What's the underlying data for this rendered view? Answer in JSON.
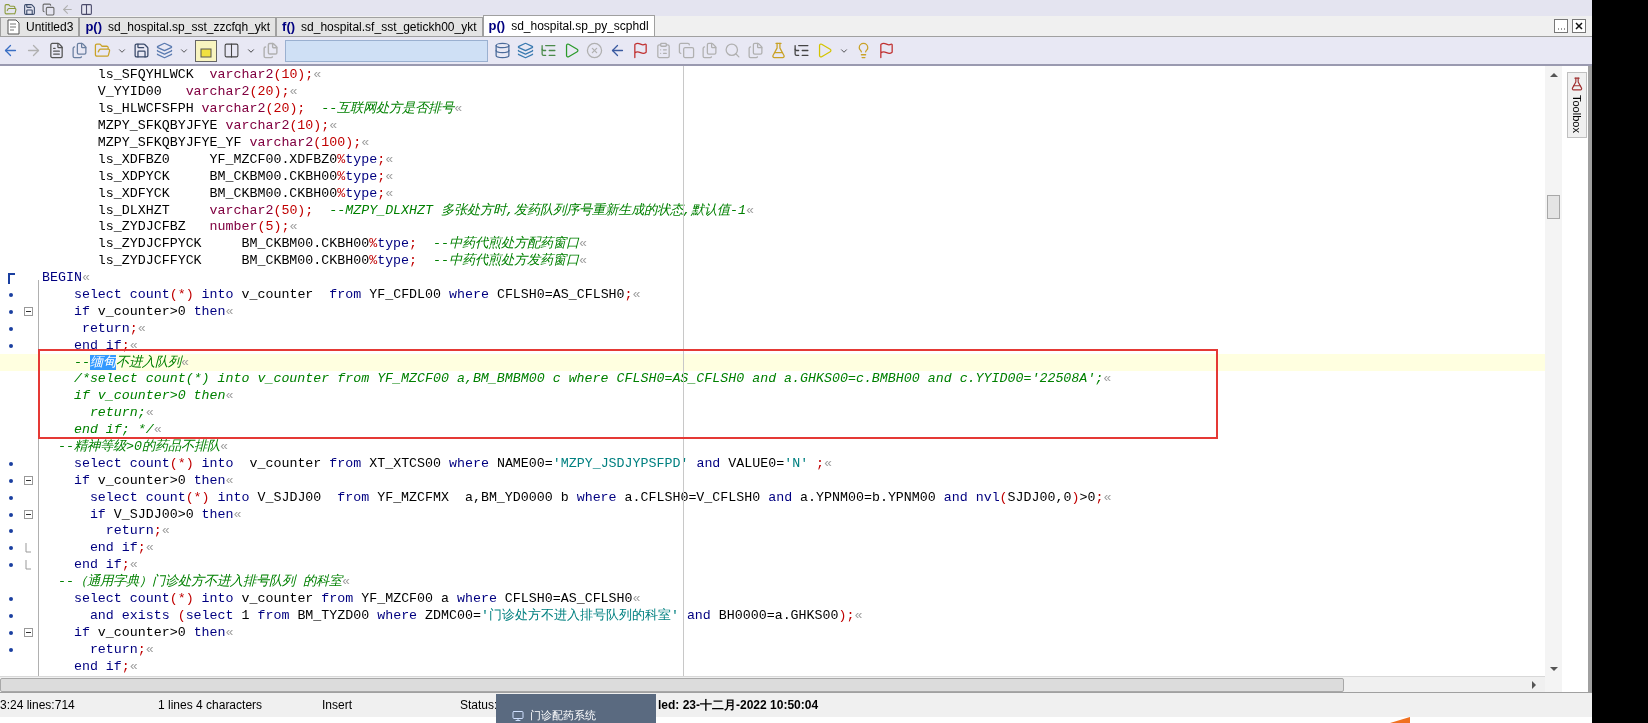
{
  "tabs": [
    {
      "kind": "sql",
      "label": "Untitled3",
      "selected": false
    },
    {
      "kind": "proc",
      "icon_text": "p()",
      "label": "sd_hospital.sp_sst_zzcfqh_ykt",
      "selected": false
    },
    {
      "kind": "proc",
      "icon_text": "f()",
      "label": "sd_hospital.sf_sst_getickh00_ykt",
      "selected": false
    },
    {
      "kind": "proc",
      "icon_text": "p()",
      "label": "sd_hospital.sp_py_scphdl",
      "selected": true
    }
  ],
  "toolbox": {
    "label": "Toolbox"
  },
  "editor": {
    "lines": [
      {
        "current": false,
        "spans": [
          {
            "kind": "plain",
            "text": "       ls_SFQYHLWCK  "
          },
          {
            "kind": "type",
            "text": "varchar2"
          },
          {
            "kind": "symbol",
            "text": "(10);"
          },
          {
            "kind": "eol",
            "text": "«"
          }
        ]
      },
      {
        "current": false,
        "spans": [
          {
            "kind": "plain",
            "text": "       V_YYID00   "
          },
          {
            "kind": "type",
            "text": "varchar2"
          },
          {
            "kind": "symbol",
            "text": "(20);"
          },
          {
            "kind": "eol",
            "text": "«"
          }
        ]
      },
      {
        "current": false,
        "spans": [
          {
            "kind": "plain",
            "text": "       ls_HLWCFSFPH "
          },
          {
            "kind": "type",
            "text": "varchar2"
          },
          {
            "kind": "symbol",
            "text": "(20);"
          },
          {
            "kind": "comment",
            "text": "  --互联网处方是否排号"
          },
          {
            "kind": "eol",
            "text": "«"
          }
        ]
      },
      {
        "current": false,
        "spans": [
          {
            "kind": "plain",
            "text": "       MZPY_SFKQBYJFYE "
          },
          {
            "kind": "type",
            "text": "varchar2"
          },
          {
            "kind": "symbol",
            "text": "(10);"
          },
          {
            "kind": "eol",
            "text": "«"
          }
        ]
      },
      {
        "current": false,
        "spans": [
          {
            "kind": "plain",
            "text": "       MZPY_SFKQBYJFYE_YF "
          },
          {
            "kind": "type",
            "text": "varchar2"
          },
          {
            "kind": "symbol",
            "text": "(100);"
          },
          {
            "kind": "eol",
            "text": "«"
          }
        ]
      },
      {
        "current": false,
        "spans": [
          {
            "kind": "plain",
            "text": "       ls_XDFBZ0     YF_MZCF00.XDFBZ0"
          },
          {
            "kind": "symbol",
            "text": "%"
          },
          {
            "kind": "keyword",
            "text": "type"
          },
          {
            "kind": "symbol",
            "text": ";"
          },
          {
            "kind": "eol",
            "text": "«"
          }
        ]
      },
      {
        "current": false,
        "spans": [
          {
            "kind": "plain",
            "text": "       ls_XDPYCK     BM_CKBM00.CKBH00"
          },
          {
            "kind": "symbol",
            "text": "%"
          },
          {
            "kind": "keyword",
            "text": "type"
          },
          {
            "kind": "symbol",
            "text": ";"
          },
          {
            "kind": "eol",
            "text": "«"
          }
        ]
      },
      {
        "current": false,
        "spans": [
          {
            "kind": "plain",
            "text": "       ls_XDFYCK     BM_CKBM00.CKBH00"
          },
          {
            "kind": "symbol",
            "text": "%"
          },
          {
            "kind": "keyword",
            "text": "type"
          },
          {
            "kind": "symbol",
            "text": ";"
          },
          {
            "kind": "eol",
            "text": "«"
          }
        ]
      },
      {
        "current": false,
        "spans": [
          {
            "kind": "plain",
            "text": "       ls_DLXHZT     "
          },
          {
            "kind": "type",
            "text": "varchar2"
          },
          {
            "kind": "symbol",
            "text": "(50);"
          },
          {
            "kind": "comment",
            "text": "  --MZPY_DLXHZT 多张处方时,发药队列序号重新生成的状态,默认值-1"
          },
          {
            "kind": "eol",
            "text": "«"
          }
        ]
      },
      {
        "current": false,
        "spans": [
          {
            "kind": "plain",
            "text": "       ls_ZYDJCFBZ   "
          },
          {
            "kind": "type",
            "text": "number"
          },
          {
            "kind": "symbol",
            "text": "(5);"
          },
          {
            "kind": "eol",
            "text": "«"
          }
        ]
      },
      {
        "current": false,
        "spans": [
          {
            "kind": "plain",
            "text": "       ls_ZYDJCFPYCK     BM_CKBM00.CKBH00"
          },
          {
            "kind": "symbol",
            "text": "%"
          },
          {
            "kind": "keyword",
            "text": "type"
          },
          {
            "kind": "symbol",
            "text": ";"
          },
          {
            "kind": "comment",
            "text": "  --中药代煎处方配药窗口"
          },
          {
            "kind": "eol",
            "text": "«"
          }
        ]
      },
      {
        "current": false,
        "spans": [
          {
            "kind": "plain",
            "text": "       ls_ZYDJCFFYCK     BM_CKBM00.CKBH00"
          },
          {
            "kind": "symbol",
            "text": "%"
          },
          {
            "kind": "keyword",
            "text": "type"
          },
          {
            "kind": "symbol",
            "text": ";"
          },
          {
            "kind": "comment",
            "text": "  --中药代煎处方发药窗口"
          },
          {
            "kind": "eol",
            "text": "«"
          }
        ]
      },
      {
        "block_start": true,
        "current": false,
        "spans": [
          {
            "kind": "keyword",
            "text": "BEGIN"
          },
          {
            "kind": "eol",
            "text": "«"
          }
        ]
      },
      {
        "executable": true,
        "current": false,
        "spans": [
          {
            "kind": "keyword",
            "text": "    select "
          },
          {
            "kind": "keyword",
            "text": "count"
          },
          {
            "kind": "symbol",
            "text": "(*)"
          },
          {
            "kind": "keyword",
            "text": " into"
          },
          {
            "kind": "plain",
            "text": " v_counter  "
          },
          {
            "kind": "keyword",
            "text": "from"
          },
          {
            "kind": "plain",
            "text": " YF_CFDL00 "
          },
          {
            "kind": "keyword",
            "text": "where"
          },
          {
            "kind": "plain",
            "text": " CFLSH0=AS_CFLSH0"
          },
          {
            "kind": "symbol",
            "text": ";"
          },
          {
            "kind": "eol",
            "text": "«"
          }
        ]
      },
      {
        "executable": true,
        "fold_open": true,
        "current": false,
        "spans": [
          {
            "kind": "keyword",
            "text": "    if"
          },
          {
            "kind": "plain",
            "text": " v_counter>0 "
          },
          {
            "kind": "keyword",
            "text": "then"
          },
          {
            "kind": "eol",
            "text": "«"
          }
        ]
      },
      {
        "executable": true,
        "current": false,
        "spans": [
          {
            "kind": "keyword",
            "text": "     return"
          },
          {
            "kind": "symbol",
            "text": ";"
          },
          {
            "kind": "eol",
            "text": "«"
          }
        ]
      },
      {
        "executable": true,
        "current": false,
        "spans": [
          {
            "kind": "keyword",
            "text": "    end if"
          },
          {
            "kind": "symbol",
            "text": ";"
          },
          {
            "kind": "eol",
            "text": "«"
          }
        ]
      },
      {
        "current": true,
        "spans": [
          {
            "kind": "comment",
            "text": "    --"
          },
          {
            "kind": "selection",
            "text": "缅甸"
          },
          {
            "kind": "comment",
            "text": "不进入队列"
          },
          {
            "kind": "eol",
            "text": "«"
          }
        ]
      },
      {
        "current": false,
        "spans": [
          {
            "kind": "comment",
            "text": "    /*select count(*) into v_counter from YF_MZCF00 a,BM_BMBM00 c where CFLSH0=AS_CFLSH0 and a.GHKS00=c.BMBH00 and c.YYID00='22508A';"
          },
          {
            "kind": "eol",
            "text": "«"
          }
        ]
      },
      {
        "current": false,
        "spans": [
          {
            "kind": "comment",
            "text": "    if v_counter>0 then"
          },
          {
            "kind": "eol",
            "text": "«"
          }
        ]
      },
      {
        "current": false,
        "spans": [
          {
            "kind": "comment",
            "text": "      return;"
          },
          {
            "kind": "eol",
            "text": "«"
          }
        ]
      },
      {
        "current": false,
        "spans": [
          {
            "kind": "comment",
            "text": "    end if; */"
          },
          {
            "kind": "eol",
            "text": "«"
          }
        ]
      },
      {
        "current": false,
        "spans": [
          {
            "kind": "comment",
            "text": "  --精神等级>0的药品不排队"
          },
          {
            "kind": "eol",
            "text": "«"
          }
        ]
      },
      {
        "executable": true,
        "current": false,
        "spans": [
          {
            "kind": "keyword",
            "text": "    select "
          },
          {
            "kind": "keyword",
            "text": "count"
          },
          {
            "kind": "symbol",
            "text": "(*)"
          },
          {
            "kind": "keyword",
            "text": " into"
          },
          {
            "kind": "plain",
            "text": "  v_counter "
          },
          {
            "kind": "keyword",
            "text": "from"
          },
          {
            "kind": "plain",
            "text": " XT_XTCS00 "
          },
          {
            "kind": "keyword",
            "text": "where"
          },
          {
            "kind": "plain",
            "text": " NAME00="
          },
          {
            "kind": "string",
            "text": "'MZPY_JSDJYPSFPD'"
          },
          {
            "kind": "keyword",
            "text": " and"
          },
          {
            "kind": "plain",
            "text": " VALUE0="
          },
          {
            "kind": "string",
            "text": "'N'"
          },
          {
            "kind": "symbol",
            "text": " ;"
          },
          {
            "kind": "eol",
            "text": "«"
          }
        ]
      },
      {
        "executable": true,
        "fold_open": true,
        "current": false,
        "spans": [
          {
            "kind": "keyword",
            "text": "    if"
          },
          {
            "kind": "plain",
            "text": " v_counter>0 "
          },
          {
            "kind": "keyword",
            "text": "then"
          },
          {
            "kind": "eol",
            "text": "«"
          }
        ]
      },
      {
        "executable": true,
        "current": false,
        "spans": [
          {
            "kind": "keyword",
            "text": "      select "
          },
          {
            "kind": "keyword",
            "text": "count"
          },
          {
            "kind": "symbol",
            "text": "(*)"
          },
          {
            "kind": "keyword",
            "text": " into"
          },
          {
            "kind": "plain",
            "text": " V_SJDJ00  "
          },
          {
            "kind": "keyword",
            "text": "from"
          },
          {
            "kind": "plain",
            "text": " YF_MZCFMX  a,BM_YD0000 b "
          },
          {
            "kind": "keyword",
            "text": "where"
          },
          {
            "kind": "plain",
            "text": " a.CFLSH0=V_CFLSH0 "
          },
          {
            "kind": "keyword",
            "text": "and"
          },
          {
            "kind": "plain",
            "text": " a.YPNM00=b.YPNM00 "
          },
          {
            "kind": "keyword",
            "text": "and nvl"
          },
          {
            "kind": "symbol",
            "text": "("
          },
          {
            "kind": "plain",
            "text": "SJDJ00,0"
          },
          {
            "kind": "symbol",
            "text": ")"
          },
          {
            "kind": "plain",
            "text": ">0"
          },
          {
            "kind": "symbol",
            "text": ";"
          },
          {
            "kind": "eol",
            "text": "«"
          }
        ]
      },
      {
        "executable": true,
        "fold_open": true,
        "current": false,
        "spans": [
          {
            "kind": "keyword",
            "text": "      if"
          },
          {
            "kind": "plain",
            "text": " V_SJDJ00>0 "
          },
          {
            "kind": "keyword",
            "text": "then"
          },
          {
            "kind": "eol",
            "text": "«"
          }
        ]
      },
      {
        "executable": true,
        "current": false,
        "spans": [
          {
            "kind": "keyword",
            "text": "        return"
          },
          {
            "kind": "symbol",
            "text": ";"
          },
          {
            "kind": "eol",
            "text": "«"
          }
        ]
      },
      {
        "executable": true,
        "fold_end": true,
        "current": false,
        "spans": [
          {
            "kind": "keyword",
            "text": "      end if"
          },
          {
            "kind": "symbol",
            "text": ";"
          },
          {
            "kind": "eol",
            "text": "«"
          }
        ]
      },
      {
        "executable": true,
        "fold_end": true,
        "current": false,
        "spans": [
          {
            "kind": "keyword",
            "text": "    end if"
          },
          {
            "kind": "symbol",
            "text": ";"
          },
          {
            "kind": "eol",
            "text": "«"
          }
        ]
      },
      {
        "current": false,
        "spans": [
          {
            "kind": "comment",
            "text": "  --（通用字典）门诊处方不进入排号队列 的科室"
          },
          {
            "kind": "eol",
            "text": "«"
          }
        ]
      },
      {
        "executable": true,
        "current": false,
        "spans": [
          {
            "kind": "keyword",
            "text": "    select "
          },
          {
            "kind": "keyword",
            "text": "count"
          },
          {
            "kind": "symbol",
            "text": "(*)"
          },
          {
            "kind": "keyword",
            "text": " into"
          },
          {
            "kind": "plain",
            "text": " v_counter "
          },
          {
            "kind": "keyword",
            "text": "from"
          },
          {
            "kind": "plain",
            "text": " YF_MZCF00 a "
          },
          {
            "kind": "keyword",
            "text": "where"
          },
          {
            "kind": "plain",
            "text": " CFLSH0=AS_CFLSH0"
          },
          {
            "kind": "eol",
            "text": "«"
          }
        ]
      },
      {
        "executable": true,
        "current": false,
        "spans": [
          {
            "kind": "keyword",
            "text": "      and exists"
          },
          {
            "kind": "symbol",
            "text": " ("
          },
          {
            "kind": "keyword",
            "text": "select"
          },
          {
            "kind": "plain",
            "text": " 1 "
          },
          {
            "kind": "keyword",
            "text": "from"
          },
          {
            "kind": "plain",
            "text": " BM_TYZD00 "
          },
          {
            "kind": "keyword",
            "text": "where"
          },
          {
            "kind": "plain",
            "text": " ZDMC00="
          },
          {
            "kind": "string",
            "text": "'门诊处方不进入排号队列的科室'"
          },
          {
            "kind": "keyword",
            "text": " and"
          },
          {
            "kind": "plain",
            "text": " BH0000=a.GHKS00"
          },
          {
            "kind": "symbol",
            "text": ");"
          },
          {
            "kind": "eol",
            "text": "«"
          }
        ]
      },
      {
        "executable": true,
        "fold_open": true,
        "current": false,
        "spans": [
          {
            "kind": "keyword",
            "text": "    if"
          },
          {
            "kind": "plain",
            "text": " v_counter>0 "
          },
          {
            "kind": "keyword",
            "text": "then"
          },
          {
            "kind": "eol",
            "text": "«"
          }
        ]
      },
      {
        "executable": true,
        "current": false,
        "spans": [
          {
            "kind": "keyword",
            "text": "      return"
          },
          {
            "kind": "symbol",
            "text": ";"
          },
          {
            "kind": "eol",
            "text": "«"
          }
        ]
      },
      {
        "current": false,
        "spans": [
          {
            "kind": "keyword",
            "text": "    end if"
          },
          {
            "kind": "symbol",
            "text": ";"
          },
          {
            "kind": "eol",
            "text": "«"
          }
        ]
      }
    ]
  },
  "status_bar": {
    "position": "3:24 lines:714",
    "selection": "1 lines 4 characters",
    "mode": "Insert",
    "status_label": "Status:",
    "status_text": "led: 23-十二月-2022 10:50:04"
  },
  "taskbar_popup": {
    "label": "门诊配药系统"
  }
}
